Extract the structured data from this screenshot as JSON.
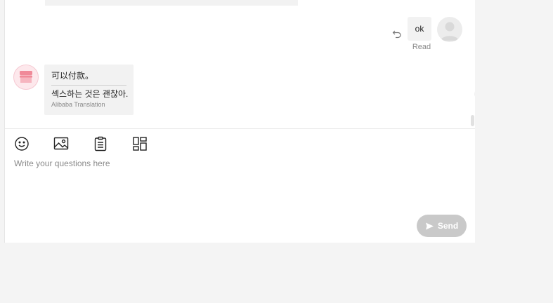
{
  "messages": {
    "outgoing": {
      "text": "ok",
      "status": "Read"
    },
    "incoming": {
      "original": "可以付款。",
      "translation": "섹스하는 것은 괜찮아.",
      "translation_source": "Alibaba Translation"
    }
  },
  "composer": {
    "placeholder": "Write your questions here",
    "send_label": "Send",
    "tools": [
      "emoji-icon",
      "image-icon",
      "clipboard-icon",
      "layout-icon"
    ]
  },
  "colors": {
    "send_disabled": "#c9c9c9",
    "bubble": "#f2f2f2",
    "seller_avatar": "#fde8ec"
  }
}
